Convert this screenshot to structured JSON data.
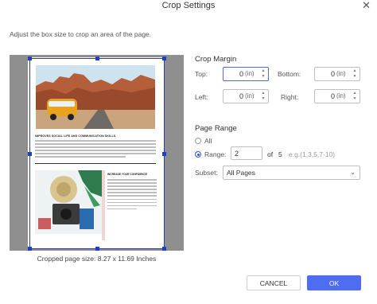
{
  "dialog": {
    "title": "Crop Settings",
    "instruction": "Adjust the box size to crop an area of the page."
  },
  "preview": {
    "headline": "IMPROVES SOCIAL LIFE AND COMMUNICATION SKILLS",
    "subheadline": "INCREASE YOUR CONFIDENCE",
    "crop_size_text": "Cropped page size: 8.27 x 11.69 Inches"
  },
  "crop_margin": {
    "section_label": "Crop Margin",
    "top": {
      "label": "Top:",
      "value": "0",
      "unit": "(in)"
    },
    "bottom": {
      "label": "Bottom:",
      "value": "0",
      "unit": "(in)"
    },
    "left": {
      "label": "Left:",
      "value": "0",
      "unit": "(in)"
    },
    "right": {
      "label": "Right:",
      "value": "0",
      "unit": "(in)"
    }
  },
  "page_range": {
    "section_label": "Page Range",
    "all_label": "All",
    "range_label": "Range:",
    "range_value": "2",
    "of_label": "of",
    "total_pages": "5",
    "hint": "e.g.(1,3,5,7-10)",
    "subset_label": "Subset:",
    "subset_value": "All Pages",
    "selected": "range"
  },
  "buttons": {
    "cancel": "CANCEL",
    "ok": "OK"
  },
  "icons": {
    "close": "close-icon",
    "spin_up": "caret-up-icon",
    "spin_down": "caret-down-icon",
    "dropdown": "chevron-down-icon"
  },
  "colors": {
    "accent": "#4f6df0",
    "handle": "#1e40c8",
    "preview_bg": "#8f8f8f"
  }
}
